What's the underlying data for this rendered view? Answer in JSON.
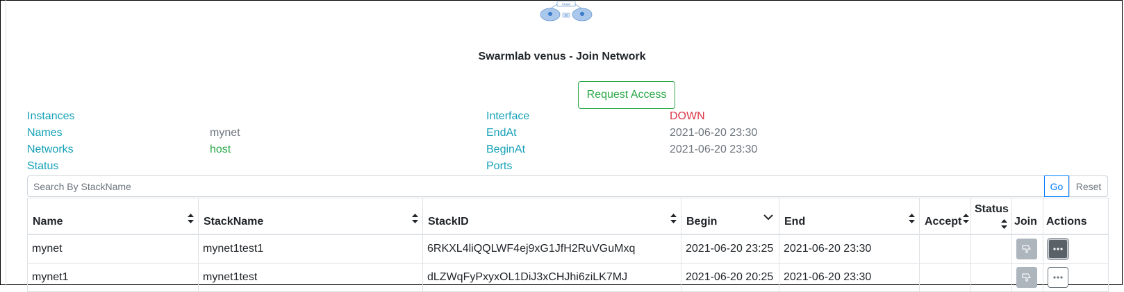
{
  "logo": {
    "label": "Cloud"
  },
  "title": "Swarmlab venus - Join Network",
  "request_access_label": "Request Access",
  "info_left": [
    {
      "label": "Instances",
      "value": ""
    },
    {
      "label": "Names",
      "value": "mynet"
    },
    {
      "label": "Networks",
      "value": "host"
    },
    {
      "label": "Status",
      "value": ""
    }
  ],
  "info_right": [
    {
      "label": "Interface",
      "value": "DOWN"
    },
    {
      "label": "EndAt",
      "value": "2021-06-20 23:30"
    },
    {
      "label": "BeginAt",
      "value": "2021-06-20 23:30"
    },
    {
      "label": "Ports",
      "value": ""
    }
  ],
  "search": {
    "placeholder": "Search By StackName",
    "go_label": "Go",
    "reset_label": "Reset"
  },
  "table": {
    "columns": [
      "Name",
      "StackName",
      "StackID",
      "Begin",
      "End",
      "Accept",
      "Status",
      "Join",
      "Actions"
    ],
    "rows": [
      {
        "name": "mynet",
        "stackname": "mynet1test1",
        "stackid": "6RKXL4liQQLWF4ej9xG1JfH2RuVGuMxq",
        "begin": "2021-06-20 23:25",
        "end": "2021-06-20 23:30",
        "accept": "",
        "status": ""
      },
      {
        "name": "mynet1",
        "stackname": "mynet1test",
        "stackid": "dLZWqFyPxyxOL1DiJ3xCHJhi6ziLK7MJ",
        "begin": "2021-06-20 20:25",
        "end": "2021-06-20 23:30",
        "accept": "",
        "status": ""
      }
    ]
  },
  "colors": {
    "label": "#17a2b8",
    "success": "#28a745",
    "danger": "#dc3545",
    "muted": "#6c757d",
    "primary": "#007bff"
  },
  "icons": {
    "join": "thumbs-down-icon",
    "actions": "ellipsis-icon",
    "sort": "sort-icon",
    "sort_desc": "chevron-down-icon"
  }
}
